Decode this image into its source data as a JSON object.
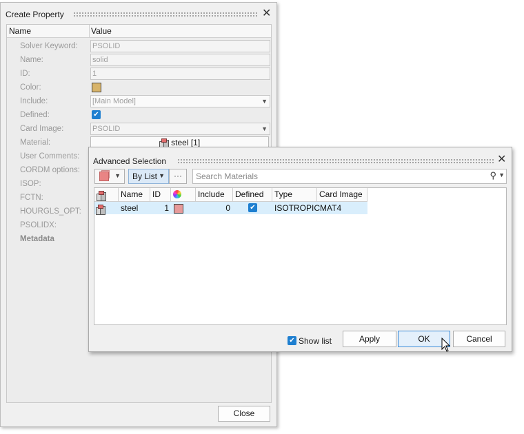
{
  "create_property": {
    "title": "Create Property",
    "columns": {
      "name": "Name",
      "value": "Value"
    },
    "rows": [
      {
        "label": "Solver Keyword:",
        "value": "PSOLID"
      },
      {
        "label": "Name:",
        "value": "solid"
      },
      {
        "label": "ID:",
        "value": "1"
      },
      {
        "label": "Color:"
      },
      {
        "label": "Include:",
        "value": "[Main Model]"
      },
      {
        "label": "Defined:"
      },
      {
        "label": "Card Image:",
        "value": "PSOLID"
      },
      {
        "label": "Material:",
        "value": "steel [1]"
      },
      {
        "label": "User Comments:"
      },
      {
        "label": "CORDM options:"
      },
      {
        "label": "ISOP:"
      },
      {
        "label": "FCTN:"
      },
      {
        "label": "HOURGLS_OPT:"
      },
      {
        "label": "PSOLIDX:"
      },
      {
        "label": "Metadata"
      }
    ],
    "color_value": "#d8b46a",
    "defined_checked": true,
    "close_label": "Close"
  },
  "advanced_selection": {
    "title": "Advanced Selection",
    "mode_label": "By List",
    "more_label": "···",
    "search_placeholder": "Search Materials",
    "headers": [
      "Name",
      "ID",
      "Include",
      "Defined",
      "Type",
      "Card Image"
    ],
    "row": {
      "name": "steel",
      "id": "1",
      "color": "#e79a9a",
      "include": "0",
      "defined": true,
      "type": "ISOTROPIC",
      "card_image": "MAT4"
    },
    "show_list_label": "Show list",
    "show_list_checked": true,
    "apply_label": "Apply",
    "ok_label": "OK",
    "cancel_label": "Cancel"
  }
}
